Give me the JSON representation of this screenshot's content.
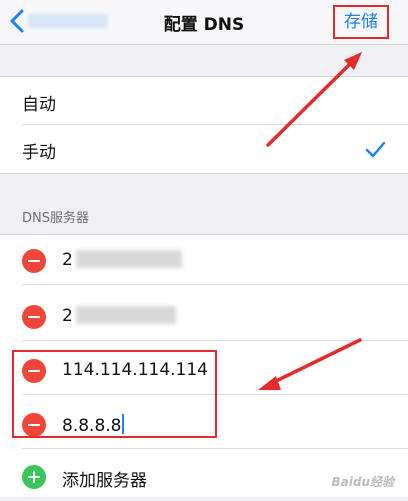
{
  "navbar": {
    "title": "配置 DNS",
    "save_label": "存储"
  },
  "mode_group": {
    "items": [
      {
        "label": "自动",
        "selected": false
      },
      {
        "label": "手动",
        "selected": true
      }
    ]
  },
  "dns_section": {
    "header": "DNS服务器",
    "servers": [
      {
        "value": "2",
        "obscured": true
      },
      {
        "value": "2",
        "obscured": true
      },
      {
        "value": "114.114.114.114",
        "obscured": false
      },
      {
        "value": "8.8.8.8",
        "obscured": false,
        "editing": true
      }
    ],
    "add_label": "添加服务器"
  },
  "watermark": "Baidu经验",
  "colors": {
    "accent": "#1b82f0",
    "annotation_red": "#e32b2b",
    "delete_red": "#f0453a",
    "add_green": "#3bc55b"
  }
}
